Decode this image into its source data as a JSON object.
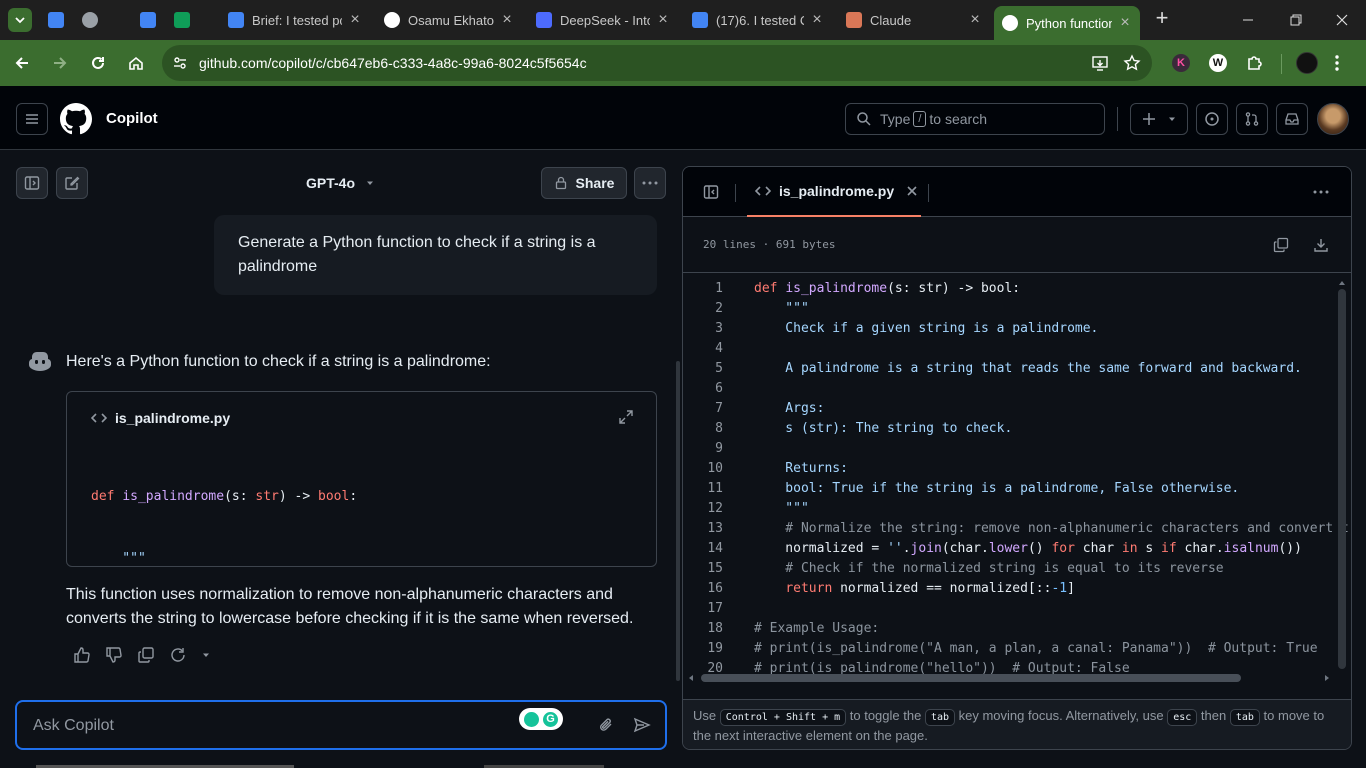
{
  "browser": {
    "tabs": [
      {
        "title": "",
        "icon": "google-docs-icon",
        "color": "#4285f4"
      },
      {
        "title": "",
        "icon": "globe-icon",
        "color": "#9aa0a6"
      },
      {
        "title": "",
        "icon": "google-docs-icon",
        "color": "#4285f4"
      },
      {
        "title": "",
        "icon": "google-sheets-icon",
        "color": "#0f9d58"
      },
      {
        "title": "Brief: I tested pc",
        "icon": "google-docs-icon",
        "color": "#4285f4"
      },
      {
        "title": "Osamu Ekhator",
        "icon": "chatgpt-icon",
        "color": "#ffffff"
      },
      {
        "title": "DeepSeek - Into",
        "icon": "deepseek-icon",
        "color": "#4d6bfe"
      },
      {
        "title": "(17)6. I tested C",
        "icon": "google-docs-icon",
        "color": "#4285f4"
      },
      {
        "title": "Claude",
        "icon": "claude-icon",
        "color": "#d97757"
      },
      {
        "title": "Python function",
        "icon": "github-icon",
        "color": "#ffffff"
      }
    ],
    "url": "github.com/copilot/c/cb647eb6-c333-4a8c-99a6-8024c5f5654c"
  },
  "header": {
    "title": "Copilot",
    "search_prefix": "Type",
    "search_key": "/",
    "search_suffix": "to search"
  },
  "chat": {
    "model": "GPT-4o",
    "share_label": "Share",
    "user_message": "Generate a Python function to check if a string is a palindrome",
    "bot_intro": "Here's a Python function to check if a string is a palindrome:",
    "code_card": {
      "filename": "is_palindrome.py",
      "preview": [
        "def is_palindrome(s: str) -> bool:",
        "    \"\"\"",
        "    Check if a given string is a palindrome.",
        "",
        "    A palindrome is a string that reads the same forward and backward."
      ]
    },
    "explanation": "This function uses normalization to remove non-alphanumeric characters and converts the string to lowercase before checking if it is the same when reversed.",
    "input_placeholder": "Ask Copilot"
  },
  "panel": {
    "filename": "is_palindrome.py",
    "meta": "20 lines · 691 bytes",
    "lines": [
      "def is_palindrome(s: str) -> bool:",
      "    \"\"\"",
      "    Check if a given string is a palindrome.",
      "",
      "    A palindrome is a string that reads the same forward and backward.",
      "",
      "    Args:",
      "    s (str): The string to check.",
      "",
      "    Returns:",
      "    bool: True if the string is a palindrome, False otherwise.",
      "    \"\"\"",
      "    # Normalize the string: remove non-alphanumeric characters and convert t",
      "    normalized = ''.join(char.lower() for char in s if char.isalnum())",
      "    # Check if the normalized string is equal to its reverse",
      "    return normalized == normalized[::-1]",
      "",
      "# Example Usage:",
      "# print(is_palindrome(\"A man, a plan, a canal: Panama\"))  # Output: True",
      "# print(is_palindrome(\"hello\"))  # Output: False"
    ],
    "footer": {
      "use": "Use",
      "key1": "Control + Shift + m",
      "t1": "to toggle the",
      "key2": "tab",
      "t2": "key moving focus. Alternatively, use",
      "key3": "esc",
      "t3": "then",
      "key4": "tab",
      "t4": "to move to",
      "t5": "the next interactive element on the page."
    }
  }
}
